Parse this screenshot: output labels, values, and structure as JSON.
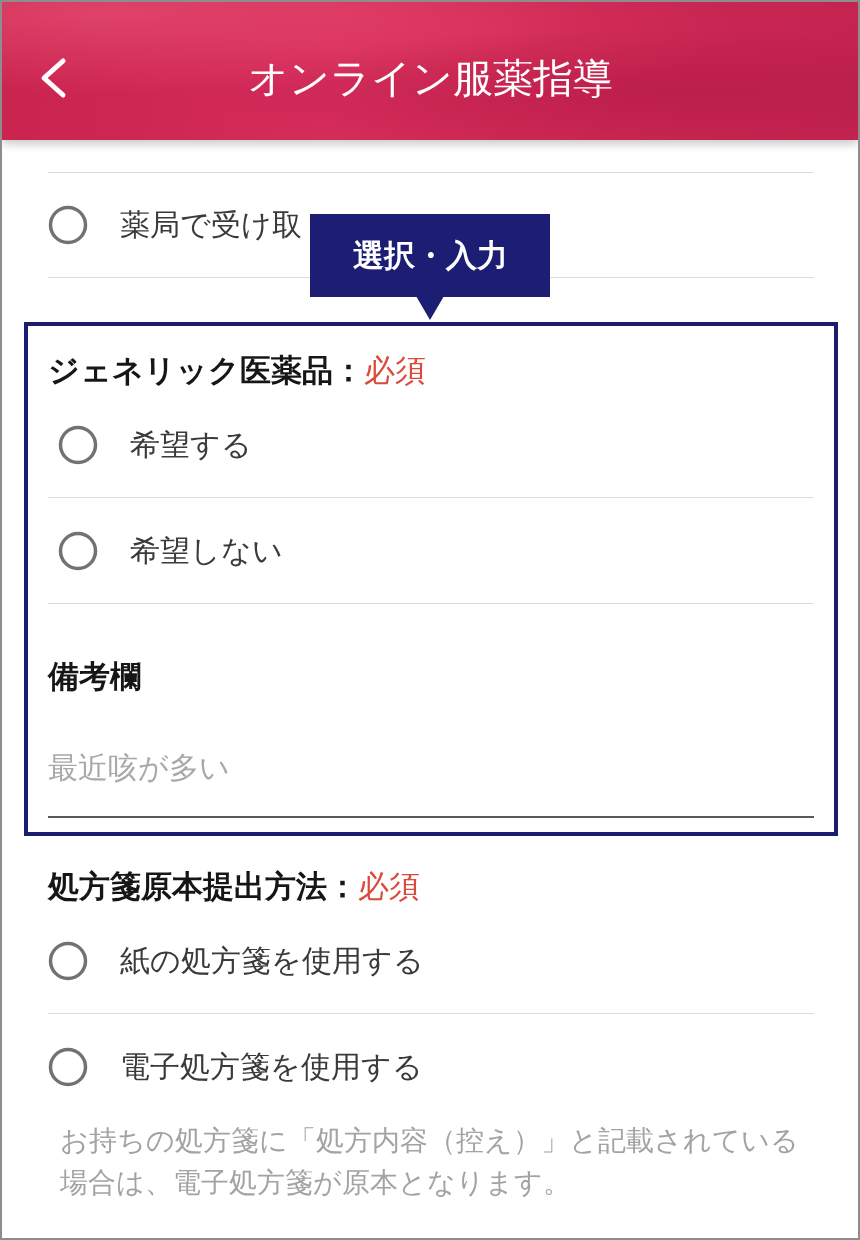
{
  "header": {
    "title": "オンライン服薬指導"
  },
  "sections": [
    {
      "kind": "radio",
      "options": [
        {
          "label": "薬局で受け取",
          "selected": false
        }
      ]
    },
    {
      "kind": "highlight",
      "callout": "選択・入力",
      "sections": [
        {
          "kind": "radio",
          "title": "ジェネリック医薬品：",
          "required": "必須",
          "options": [
            {
              "label": "希望する",
              "selected": false
            },
            {
              "label": "希望しない",
              "selected": false
            }
          ]
        },
        {
          "kind": "text",
          "title": "備考欄",
          "placeholder": "最近咳が多い"
        }
      ]
    },
    {
      "kind": "radio",
      "title": "処方箋原本提出方法：",
      "required": "必須",
      "options": [
        {
          "label": "紙の処方箋を使用する",
          "selected": false
        },
        {
          "label": "電子処方箋を使用する",
          "selected": false
        }
      ],
      "note": "お持ちの処方箋に「処方内容（控え）」と記載されている場合は、電子処方箋が原本となります。"
    }
  ]
}
